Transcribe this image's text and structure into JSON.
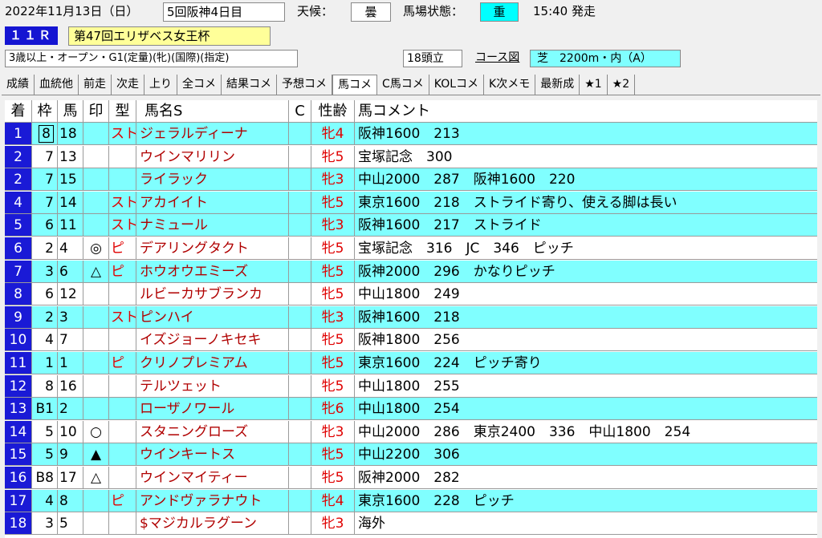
{
  "header": {
    "date": "2022年11月13日（日）",
    "meeting": "5回阪神4日目",
    "weather_label": "天候：",
    "weather": "曇",
    "track_label": "馬場状態：",
    "track": "重",
    "post_time": "15:40 発走",
    "race_no": "１１Ｒ",
    "race_name": "第47回エリザベス女王杯",
    "conditions": "3歳以上・オープン・G1(定量)(牝)(国際)(指定)",
    "runners": "18頭立",
    "course_link": "コース図",
    "course": "芝　2200m・内（A）"
  },
  "tabs": [
    "成績",
    "血統他",
    "前走",
    "次走",
    "上り",
    "全コメ",
    "結果コメ",
    "予想コメ",
    "馬コメ",
    "C馬コメ",
    "KOLコメ",
    "K次メモ",
    "最新成",
    "★1",
    "★2"
  ],
  "active_tab": "馬コメ",
  "columns": {
    "rank": "着",
    "frame": "枠",
    "num": "馬",
    "mark": "印",
    "type": "型",
    "name": "馬名S",
    "c": "C",
    "sex": "性齢",
    "comment": "馬コメント"
  },
  "rows": [
    {
      "rank": "1",
      "frame": "8",
      "num": "18",
      "mark": "",
      "type": "スト",
      "name": "ジェラルディーナ",
      "c": "",
      "sex": "牝4",
      "comment": "阪神1600　213",
      "boxed": true,
      "bg": "cyan"
    },
    {
      "rank": "2",
      "frame": "7",
      "num": "13",
      "mark": "",
      "type": "",
      "name": "ウインマリリン",
      "c": "",
      "sex": "牝5",
      "comment": "宝塚記念　300",
      "bg": "white"
    },
    {
      "rank": "2",
      "frame": "7",
      "num": "15",
      "mark": "",
      "type": "",
      "name": "ライラック",
      "c": "",
      "sex": "牝3",
      "comment": "中山2000　287　阪神1600　220",
      "bg": "cyan"
    },
    {
      "rank": "4",
      "frame": "7",
      "num": "14",
      "mark": "",
      "type": "スト",
      "name": "アカイイト",
      "c": "",
      "sex": "牝5",
      "comment": "東京1600　218　ストライド寄り、使える脚は長い",
      "bg": "cyan"
    },
    {
      "rank": "5",
      "frame": "6",
      "num": "11",
      "mark": "",
      "type": "スト",
      "name": "ナミュール",
      "c": "",
      "sex": "牝3",
      "comment": "阪神1600　217　ストライド",
      "bg": "cyan"
    },
    {
      "rank": "6",
      "frame": "2",
      "num": "4",
      "mark": "◎",
      "type": "ピ",
      "name": "デアリングタクト",
      "c": "",
      "sex": "牝5",
      "comment": "宝塚記念　316　JC　346　ピッチ",
      "bg": "white"
    },
    {
      "rank": "7",
      "frame": "3",
      "num": "6",
      "mark": "△",
      "type": "ピ",
      "name": "ホウオウエミーズ",
      "c": "",
      "sex": "牝5",
      "comment": "阪神2000　296　かなりピッチ",
      "bg": "cyan"
    },
    {
      "rank": "8",
      "frame": "6",
      "num": "12",
      "mark": "",
      "type": "",
      "name": "ルビーカサブランカ",
      "c": "",
      "sex": "牝5",
      "comment": "中山1800　249",
      "bg": "white"
    },
    {
      "rank": "9",
      "frame": "2",
      "num": "3",
      "mark": "",
      "type": "スト",
      "name": "ピンハイ",
      "c": "",
      "sex": "牝3",
      "comment": "阪神1600　218",
      "bg": "cyan"
    },
    {
      "rank": "10",
      "frame": "4",
      "num": "7",
      "mark": "",
      "type": "",
      "name": "イズジョーノキセキ",
      "c": "",
      "sex": "牝5",
      "comment": "阪神1800　256",
      "bg": "white"
    },
    {
      "rank": "11",
      "frame": "1",
      "num": "1",
      "mark": "",
      "type": "ピ",
      "name": "クリノプレミアム",
      "c": "",
      "sex": "牝5",
      "comment": "東京1600　224　ピッチ寄り",
      "bg": "cyan"
    },
    {
      "rank": "12",
      "frame": "8",
      "num": "16",
      "mark": "",
      "type": "",
      "name": "テルツェット",
      "c": "",
      "sex": "牝5",
      "comment": "中山1800　255",
      "bg": "white"
    },
    {
      "rank": "13",
      "frame": "B1",
      "num": "2",
      "mark": "",
      "type": "",
      "name": "ローザノワール",
      "c": "",
      "sex": "牝6",
      "comment": "中山1800　254",
      "bg": "cyan"
    },
    {
      "rank": "14",
      "frame": "5",
      "num": "10",
      "mark": "○",
      "type": "",
      "name": "スタニングローズ",
      "c": "",
      "sex": "牝3",
      "comment": "中山2000　286　東京2400　336　中山1800　254",
      "bg": "white"
    },
    {
      "rank": "15",
      "frame": "5",
      "num": "9",
      "mark": "▲",
      "type": "",
      "name": "ウインキートス",
      "c": "",
      "sex": "牝5",
      "comment": "中山2200　306",
      "bg": "cyan"
    },
    {
      "rank": "16",
      "frame": "B8",
      "num": "17",
      "mark": "△",
      "type": "",
      "name": "ウインマイティー",
      "c": "",
      "sex": "牝5",
      "comment": "阪神2000　282",
      "bg": "white"
    },
    {
      "rank": "17",
      "frame": "4",
      "num": "8",
      "mark": "",
      "type": "ピ",
      "name": "アンドヴァラナウト",
      "c": "",
      "sex": "牝4",
      "comment": "東京1600　228　ピッチ",
      "bg": "cyan"
    },
    {
      "rank": "18",
      "frame": "3",
      "num": "5",
      "mark": "",
      "type": "",
      "name": "$マジカルラグーン",
      "c": "",
      "sex": "牝3",
      "comment": "海外",
      "bg": "white"
    }
  ]
}
